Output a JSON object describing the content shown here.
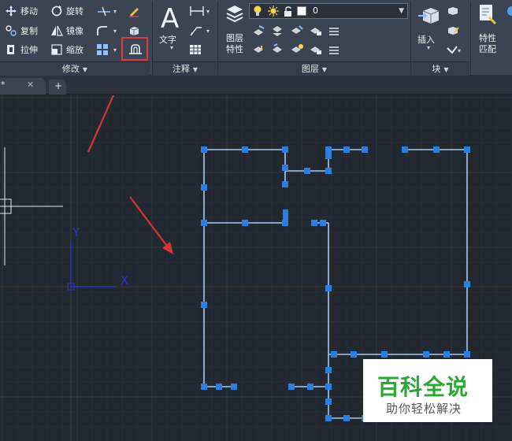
{
  "ribbon": {
    "modify": {
      "title": "修改",
      "move": "移动",
      "rotate": "旋转",
      "copy": "复制",
      "mirror": "镜像",
      "stretch": "拉伸",
      "scale": "缩放"
    },
    "annotation": {
      "title": "注释",
      "text": "文字"
    },
    "layers": {
      "title": "图层",
      "layer_props_line1": "图层",
      "layer_props_line2": "特性",
      "current_layer": "0"
    },
    "block": {
      "title": "块",
      "insert": "插入"
    },
    "props": {
      "match_line1": "特性",
      "match_line2": "匹配"
    }
  },
  "tabs": {
    "doc_tab_text": "*",
    "new_tab": "+"
  },
  "ucs": {
    "x": "X",
    "y": "Y"
  },
  "watermark": {
    "title": "百科全说",
    "subtitle": "助你轻松解决"
  },
  "colors": {
    "ribbon_bg": "#3b4453",
    "canvas_bg": "#212830",
    "selection": "#2a7fe6",
    "highlight_box": "#e03c3c",
    "annotation_arrow": "#d83434",
    "watermark_green": "#2aa835"
  }
}
